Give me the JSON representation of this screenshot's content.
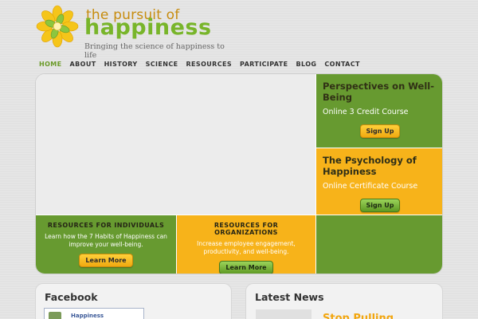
{
  "brand": {
    "title_line1": "the pursuit of",
    "title_line2": "happiness",
    "tagline": "Bringing the science of happiness to life",
    "colors": {
      "green": "#679a30",
      "yellow": "#f7b31a",
      "orange_text": "#c78c0e"
    }
  },
  "nav": {
    "items": [
      "HOME",
      "ABOUT",
      "HISTORY",
      "SCIENCE",
      "RESOURCES",
      "PARTICIPATE",
      "BLOG",
      "CONTACT"
    ],
    "active": "HOME"
  },
  "promos": {
    "wellbeing": {
      "title": "Perspectives on Well-Being",
      "subtitle": "Online 3 Credit Course",
      "button": "Sign Up"
    },
    "psychology": {
      "title": "The Psychology of Happiness",
      "subtitle": "Online Certificate Course",
      "button": "Sign Up"
    }
  },
  "resources": {
    "individuals": {
      "title": "RESOURCES FOR INDIVIDUALS",
      "text": "Learn how the 7 Habits of Happiness can improve your well-being.",
      "button": "Learn More"
    },
    "organizations": {
      "title": "RESOURCES FOR ORGANIZATIONS",
      "text": "Increase employee engagement, productivity, and well-being.",
      "button": "Learn More"
    }
  },
  "facebook": {
    "title": "Facebook",
    "page_name": "Happiness"
  },
  "news": {
    "title": "Latest News",
    "headline_fragment": "Stop Pulling"
  }
}
